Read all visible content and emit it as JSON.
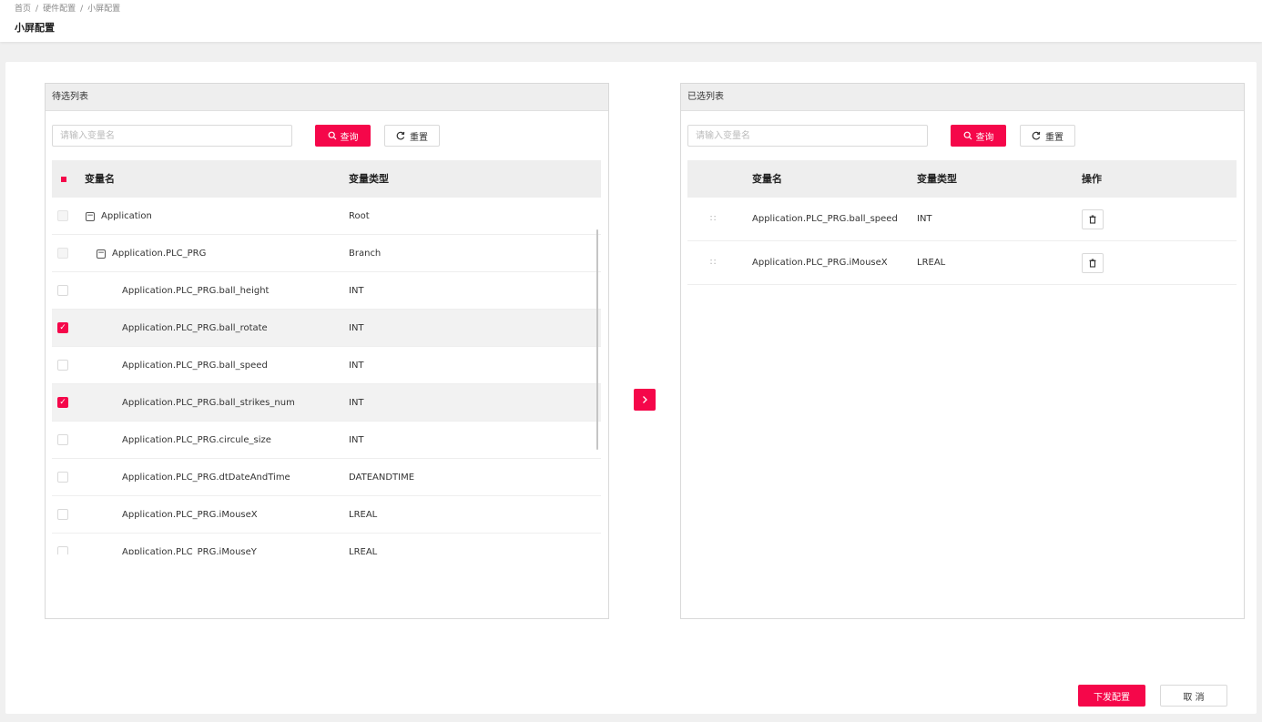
{
  "breadcrumb": [
    "首页",
    "硬件配置",
    "小屏配置"
  ],
  "breadcrumb_sep": "/",
  "page_title": "小屏配置",
  "theme": {
    "accent": "#f5074a"
  },
  "left_panel": {
    "title": "待选列表",
    "search_placeholder": "请输入变量名",
    "query_label": "查询",
    "reset_label": "重置",
    "columns": {
      "name": "变量名",
      "type": "变量类型"
    },
    "header_check_state": "indeterminate",
    "rows": [
      {
        "name": "Application",
        "type": "Root",
        "level": 0,
        "expander": "−",
        "checked": false,
        "disabled": true
      },
      {
        "name": "Application.PLC_PRG",
        "type": "Branch",
        "level": 1,
        "expander": "−",
        "checked": false,
        "disabled": true
      },
      {
        "name": "Application.PLC_PRG.ball_height",
        "type": "INT",
        "level": 2,
        "checked": false,
        "disabled": false
      },
      {
        "name": "Application.PLC_PRG.ball_rotate",
        "type": "INT",
        "level": 2,
        "checked": true,
        "disabled": false
      },
      {
        "name": "Application.PLC_PRG.ball_speed",
        "type": "INT",
        "level": 2,
        "checked": false,
        "disabled": false
      },
      {
        "name": "Application.PLC_PRG.ball_strikes_num",
        "type": "INT",
        "level": 2,
        "checked": true,
        "disabled": false
      },
      {
        "name": "Application.PLC_PRG.circule_size",
        "type": "INT",
        "level": 2,
        "checked": false,
        "disabled": false
      },
      {
        "name": "Application.PLC_PRG.dtDateAndTime",
        "type": "DATEANDTIME",
        "level": 2,
        "checked": false,
        "disabled": false
      },
      {
        "name": "Application.PLC_PRG.iMouseX",
        "type": "LREAL",
        "level": 2,
        "checked": false,
        "disabled": false
      },
      {
        "name": "Application.PLC_PRG.iMouseY",
        "type": "LREAL",
        "level": 2,
        "checked": false,
        "disabled": false
      }
    ]
  },
  "transfer_icon": "chevron-right-icon",
  "right_panel": {
    "title": "已选列表",
    "search_placeholder": "请输入变量名",
    "query_label": "查询",
    "reset_label": "重置",
    "columns": {
      "name": "变量名",
      "type": "变量类型",
      "action": "操作"
    },
    "rows": [
      {
        "name": "Application.PLC_PRG.ball_speed",
        "type": "INT"
      },
      {
        "name": "Application.PLC_PRG.iMouseX",
        "type": "LREAL"
      }
    ]
  },
  "footer": {
    "submit_label": "下发配置",
    "cancel_label": "取 消"
  }
}
